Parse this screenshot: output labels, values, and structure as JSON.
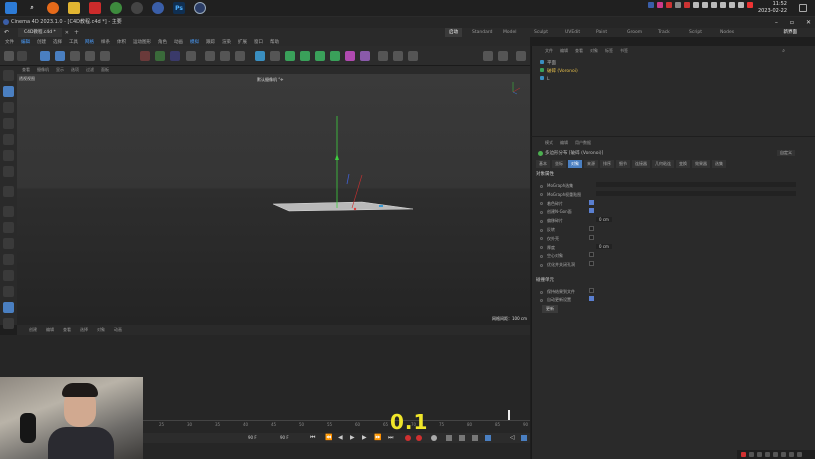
{
  "taskbar": {
    "apps": [
      "windows-start",
      "search",
      "firefox",
      "file-explorer",
      "app-red",
      "chrome",
      "app-steam",
      "app-chrome2",
      "photoshop",
      "cinema4d"
    ],
    "time": "11:52",
    "date": "2023-02-22"
  },
  "window": {
    "title": "Cinema 4D 2023.1.0 - [C4D教程.c4d *] - 主要",
    "doc_tab": "C4D教程.c4d *",
    "layouts": [
      "启动",
      "Standard",
      "Model",
      "Sculpt",
      "UVEdit",
      "Paint",
      "Groom",
      "Track",
      "Script",
      "Nodes"
    ],
    "active_layout": "启动",
    "new_scene": "新界面"
  },
  "menubar": [
    "文件",
    "编辑",
    "创建",
    "选择",
    "工具",
    "网格",
    "样条",
    "体积",
    "运动图形",
    "角色",
    "动画",
    "模拟",
    "跟踪",
    "渲染",
    "扩展",
    "窗口",
    "帮助"
  ],
  "menubar_selected": [
    "编辑",
    "网格",
    "模拟"
  ],
  "viewport": {
    "menu": [
      "查看",
      "摄像机",
      "显示",
      "选项",
      "过滤",
      "面板"
    ],
    "label": "透视视图",
    "camera": "默认摄像机 °✈",
    "grid": "网格间距：100 cm"
  },
  "timeline": {
    "menu": [
      "创建",
      "编辑",
      "查看",
      "选择",
      "对象",
      "动画"
    ],
    "ticks": [
      "25",
      "30",
      "35",
      "40",
      "45",
      "50",
      "55",
      "60",
      "65",
      "70",
      "75",
      "80",
      "85",
      "90"
    ],
    "frame_start": "90 F",
    "frame_end": "90 F",
    "overlay_value": "0.1"
  },
  "objects": {
    "menu": [
      "文件",
      "编辑",
      "查看",
      "对象",
      "标签",
      "书签"
    ],
    "rows": [
      {
        "name": "平面",
        "color": "#b5b5b5"
      },
      {
        "name": "破碎 (Voronoi)",
        "color": "#e8c04a"
      },
      {
        "name": "L",
        "color": "#b5b5b5"
      }
    ]
  },
  "attributes": {
    "menu": [
      "模式",
      "编辑",
      "用户数据"
    ],
    "title": "多边形分布 [破碎 (Voronoi)]",
    "mode": "自定义",
    "tabs": [
      "基本",
      "坐标",
      "对象",
      "来源",
      "排序",
      "细节",
      "连接器",
      "几何粘连",
      "变换",
      "效果器",
      "选集"
    ],
    "active_tab": "对象",
    "section": "对象属性",
    "props": [
      {
        "label": "MoGraph选集",
        "type": "field"
      },
      {
        "label": "MoGraph权重贴图",
        "type": "field"
      },
      {
        "label": "着色碎片",
        "type": "check",
        "on": true
      },
      {
        "label": "创建N-Gon面",
        "type": "check",
        "on": true
      },
      {
        "label": "偏移碎片",
        "type": "value",
        "value": "0 cm"
      },
      {
        "label": "反转",
        "type": "check",
        "on": false
      },
      {
        "label": "仅外壳",
        "type": "check",
        "on": false
      },
      {
        "label": "厚度",
        "type": "value",
        "value": "0 cm"
      },
      {
        "label": "空心对象",
        "type": "check",
        "on": false
      },
      {
        "label": "优化并关闭孔洞",
        "type": "check",
        "on": false
      }
    ],
    "cache_section": "碰撞单元",
    "cache_props": [
      {
        "label": "保持结果到文件",
        "on": false
      },
      {
        "label": "自动更新设置",
        "on": true
      }
    ],
    "update_button": "更新"
  },
  "colors": {
    "accent": "#4a9eff",
    "active_tab": "#4a7fc1",
    "object_highlight": "#e8c04a",
    "overlay_text": "#f0e62a"
  }
}
